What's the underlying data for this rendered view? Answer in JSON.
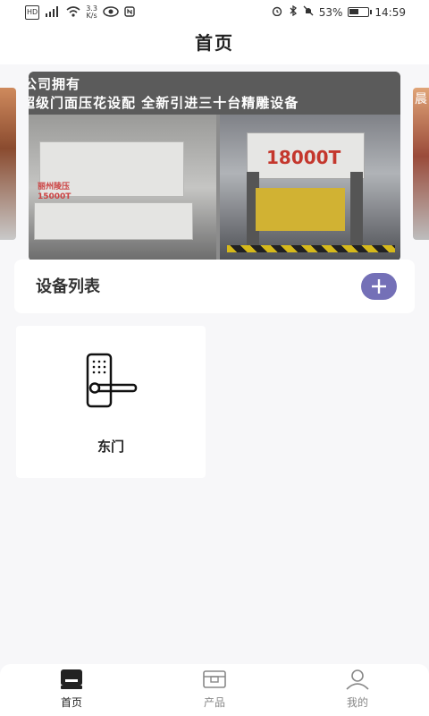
{
  "status": {
    "left_icons": [
      "hd-icon",
      "4g-signal-icon",
      "wifi-icon",
      "net-speed-icon",
      "eye-icon",
      "nfc-icon"
    ],
    "hd": "HD",
    "net_speed_value": "3.3",
    "net_speed_unit": "K/s",
    "right_icons": [
      "alarm-icon",
      "bluetooth-icon",
      "mute-icon",
      "battery-icon"
    ],
    "battery_text": "53%",
    "battery_level": 0.53,
    "time": "14:59"
  },
  "header": {
    "title": "首页"
  },
  "banner": {
    "line1": "公司拥有",
    "line2": "超级门面压花设配  全新引进三十台精雕设备",
    "machine_left_label": "丽州陵压 15000T",
    "machine_right_label": "18000T",
    "side_right_char": "晨"
  },
  "device_list": {
    "title": "设备列表",
    "add_icon": "plus-icon",
    "accent_color": "#7470b7"
  },
  "devices": [
    {
      "name": "东门",
      "icon": "door-lock-icon"
    }
  ],
  "tabbar": {
    "items": [
      {
        "label": "首页",
        "icon": "home-icon",
        "active": true
      },
      {
        "label": "产品",
        "icon": "product-icon",
        "active": false
      },
      {
        "label": "我的",
        "icon": "user-icon",
        "active": false
      }
    ]
  }
}
